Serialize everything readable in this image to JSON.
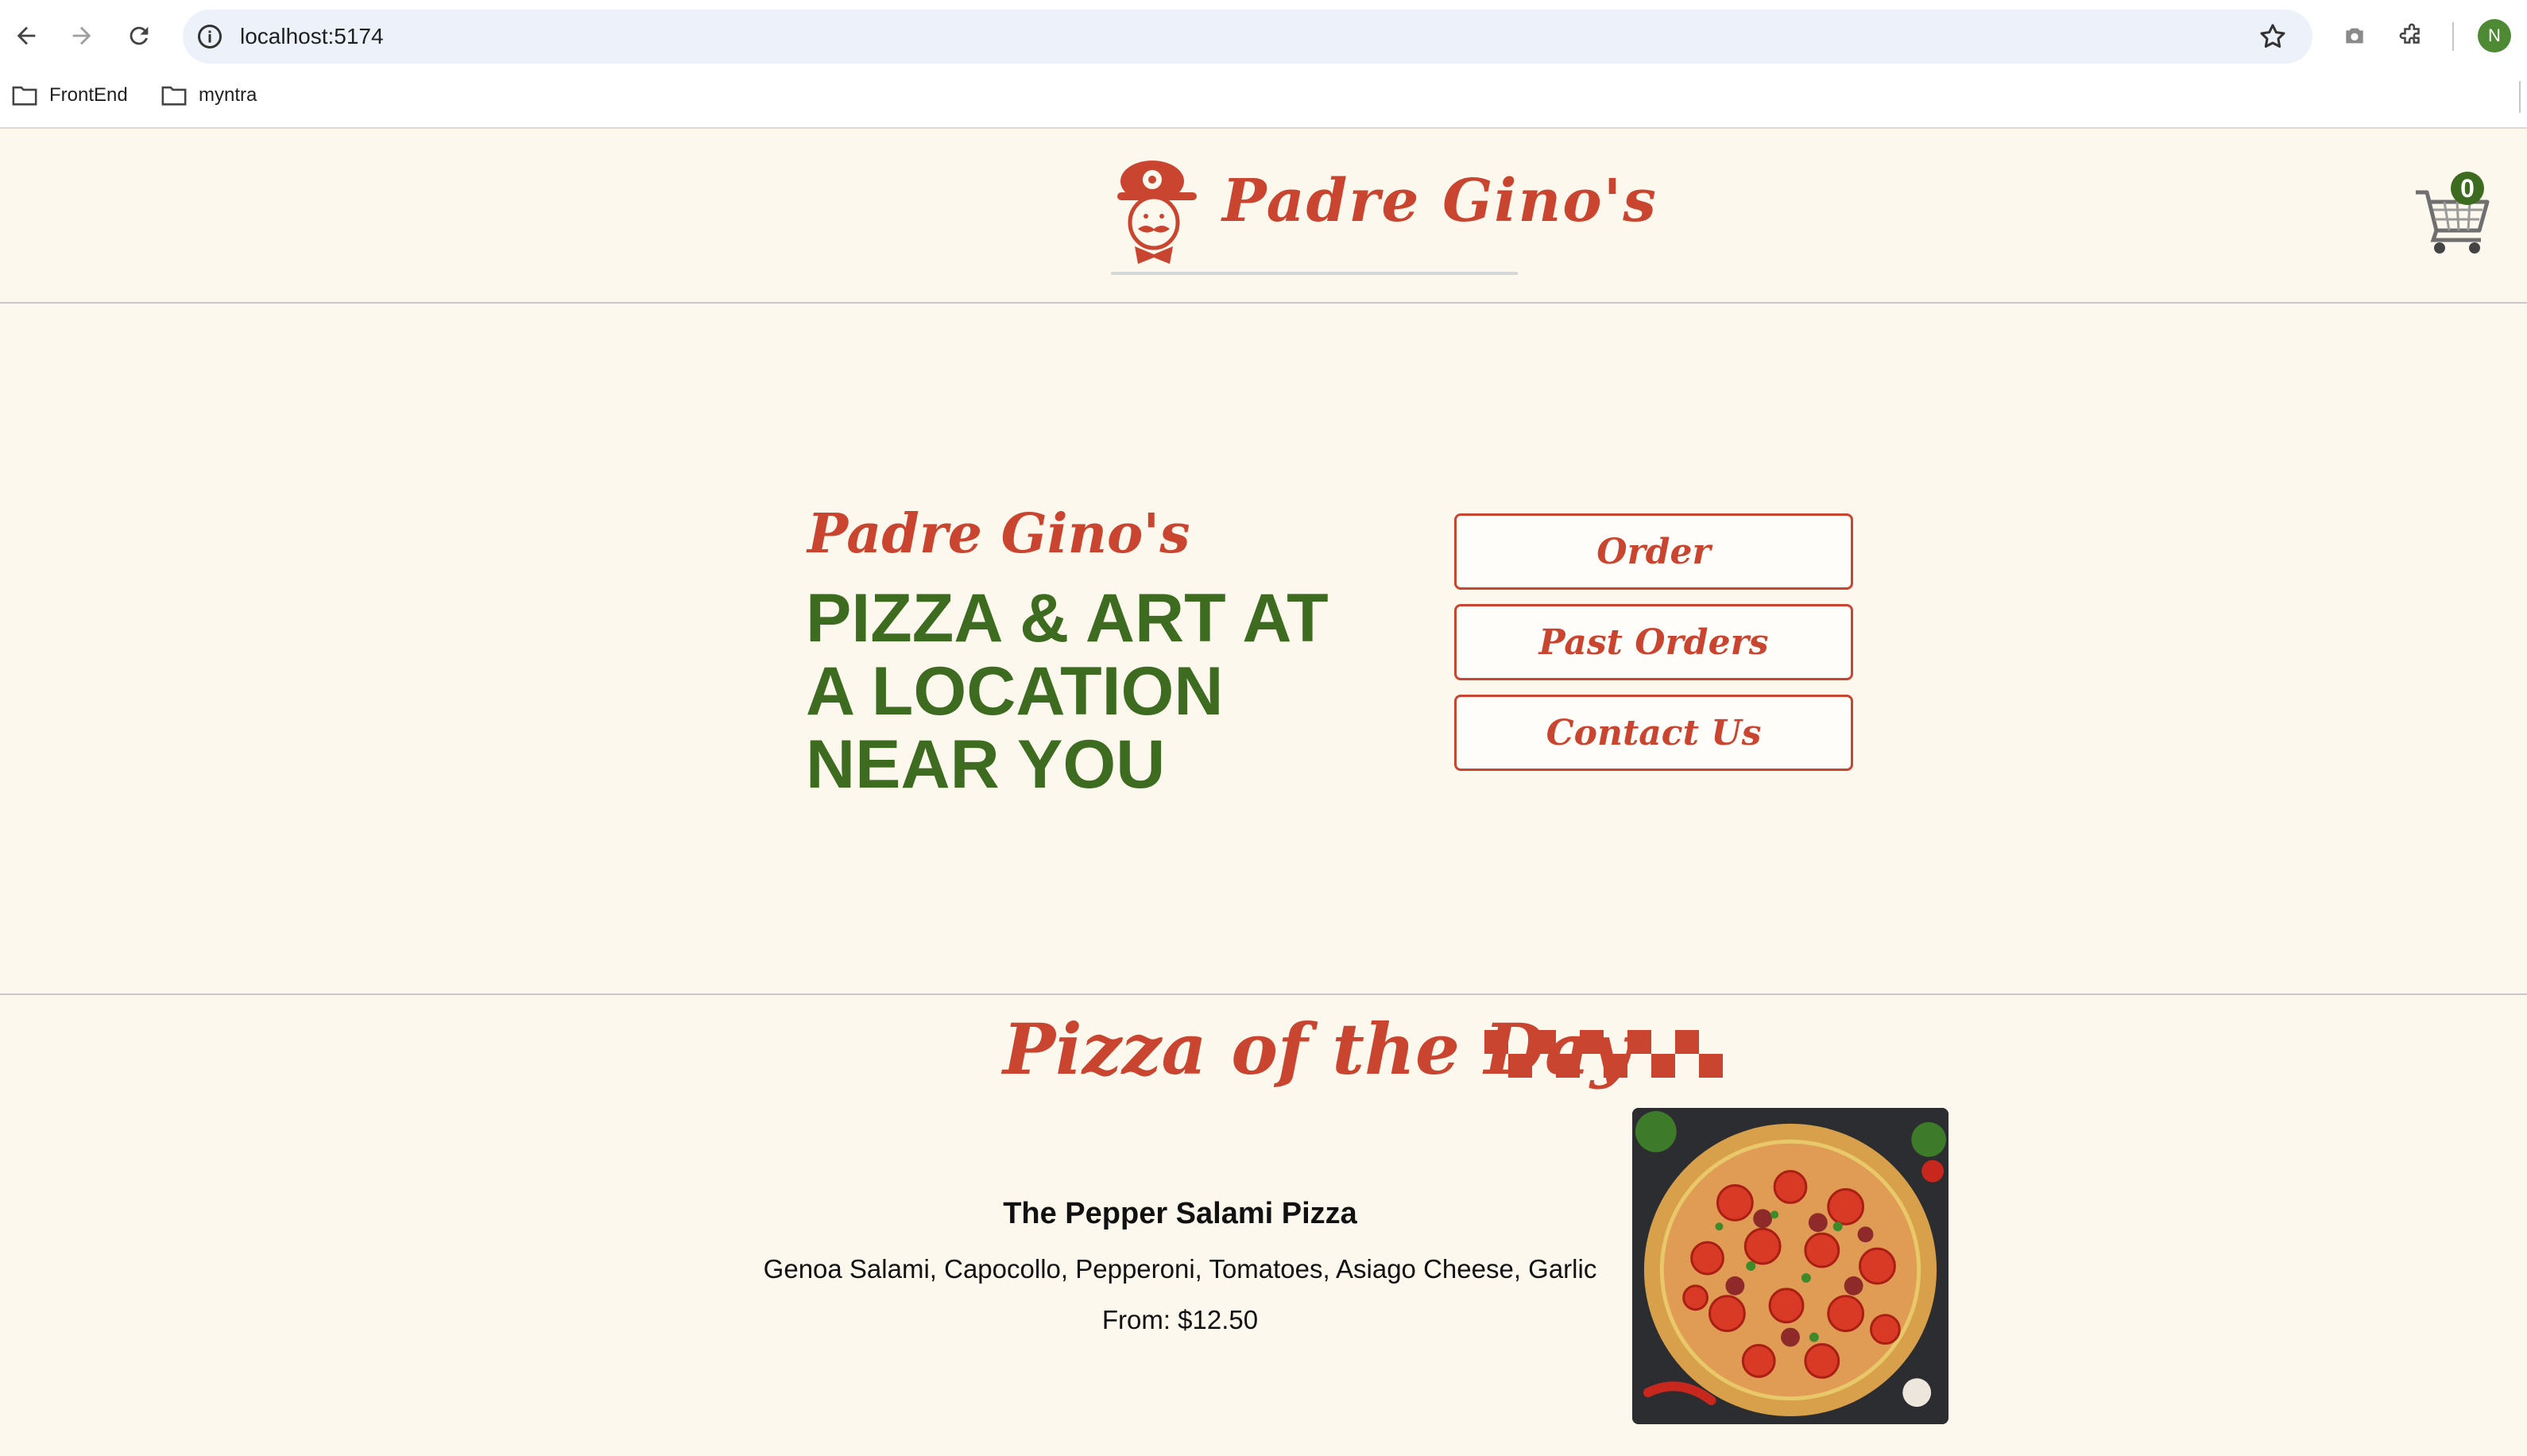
{
  "browser": {
    "url": "localhost:5174",
    "bookmarks": [
      {
        "label": "FrontEnd"
      },
      {
        "label": "myntra"
      }
    ],
    "profile_initial": "N"
  },
  "header": {
    "logo_text": "Padre Gino's",
    "cart_count": "0"
  },
  "hero": {
    "title": "Padre Gino's",
    "slogan_lines": [
      "PIZZA & ART AT",
      "A LOCATION",
      "NEAR YOU"
    ],
    "buttons": [
      {
        "label": "Order"
      },
      {
        "label": "Past Orders"
      },
      {
        "label": "Contact Us"
      }
    ]
  },
  "pizza_of_the_day": {
    "heading": "Pizza of the Day",
    "name": "The Pepper Salami Pizza",
    "description": "Genoa Salami, Capocollo, Pepperoni, Tomatoes, Asiago Cheese, Garlic",
    "price": "From: $12.50"
  },
  "colors": {
    "brand_red": "#c9452f",
    "brand_green": "#3d6b1f",
    "page_bg": "#fdf8ee"
  }
}
